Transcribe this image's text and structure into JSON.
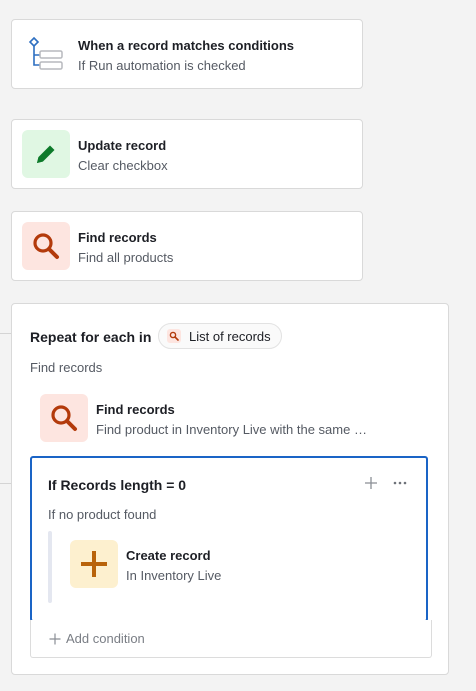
{
  "trigger": {
    "title": "When a record matches conditions",
    "subtitle": "If Run automation is checked",
    "icon": "condition-tree-icon"
  },
  "update_step": {
    "title": "Update record",
    "subtitle": "Clear checkbox",
    "icon": "pencil-icon"
  },
  "find_step": {
    "title": "Find records",
    "subtitle": "Find all products",
    "icon": "search-icon"
  },
  "repeat": {
    "title": "Repeat for each in",
    "token_label": "List of records",
    "subtitle": "Find records",
    "inner_step": {
      "title": "Find records",
      "subtitle": "Find product in Inventory Live with the same …",
      "icon": "search-icon"
    },
    "condition": {
      "title": "If Records length = 0",
      "subtitle": "If no product found",
      "add_icon": "plus-icon",
      "more_icon": "more-icon",
      "action": {
        "title": "Create record",
        "subtitle": "In Inventory Live",
        "icon": "plus-icon"
      }
    },
    "add_condition_label": "Add condition"
  },
  "colors": {
    "update_bg": "#e0f7e3",
    "update_fg": "#0d7a2a",
    "find_bg": "#fde5e0",
    "find_fg": "#b33a0b",
    "create_bg": "#fdf0cf",
    "create_fg": "#b8630b",
    "selected_border": "#1a64c6"
  }
}
